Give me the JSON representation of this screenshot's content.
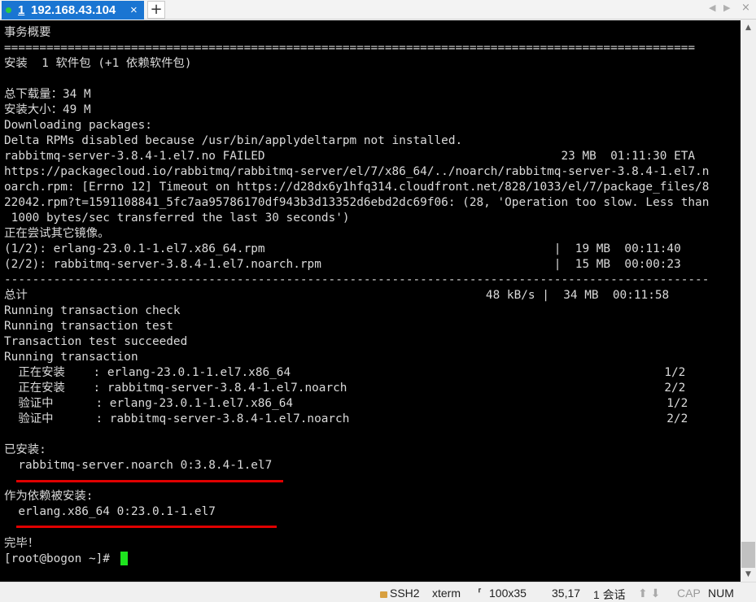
{
  "tab": {
    "number": "1",
    "host": "192.168.43.104",
    "close_glyph": "×",
    "new_tab_glyph": "+",
    "status_color": "#2ecc40"
  },
  "tab_nav": {
    "left": "◀",
    "right": "▶",
    "close": "×"
  },
  "terminal": {
    "lines": [
      "事务概要",
      "==================================================================================================",
      "安装  1 软件包 (+1 依赖软件包)",
      "",
      "总下载量：34 M",
      "安装大小：49 M",
      "Downloading packages:",
      "Delta RPMs disabled because /usr/bin/applydeltarpm not installed.",
      "rabbitmq-server-3.8.4-1.el7.no FAILED                                          23 MB  01:11:30 ETA",
      "https://packagecloud.io/rabbitmq/rabbitmq-server/el/7/x86_64/../noarch/rabbitmq-server-3.8.4-1.el7.n",
      "oarch.rpm: [Errno 12] Timeout on https://d28dx6y1hfq314.cloudfront.net/828/1033/el/7/package_files/8",
      "22042.rpm?t=1591108841_5fc7aa95786170df943b3d13352d6ebd2dc69f06: (28, 'Operation too slow. Less than",
      " 1000 bytes/sec transferred the last 30 seconds')",
      "正在尝试其它镜像。",
      "(1/2): erlang-23.0.1-1.el7.x86_64.rpm                                         |  19 MB  00:11:40",
      "(2/2): rabbitmq-server-3.8.4-1.el7.noarch.rpm                                 |  15 MB  00:00:23",
      "----------------------------------------------------------------------------------------------------",
      "总计                                                                 48 kB/s |  34 MB  00:11:58",
      "Running transaction check",
      "Running transaction test",
      "Transaction test succeeded",
      "Running transaction",
      "  正在安装    : erlang-23.0.1-1.el7.x86_64                                                     1/2",
      "  正在安装    : rabbitmq-server-3.8.4-1.el7.noarch                                             2/2",
      "  验证中      : erlang-23.0.1-1.el7.x86_64                                                     1/2",
      "  验证中      : rabbitmq-server-3.8.4-1.el7.noarch                                             2/2",
      "",
      "已安装:",
      "  rabbitmq-server.noarch 0:3.8.4-1.el7",
      "",
      "作为依赖被安装:",
      "  erlang.x86_64 0:23.0.1-1.el7",
      "",
      "完毕！",
      "[root@bogon ~]# "
    ],
    "cursor_color": "#1ee51e",
    "underline_color": "#e00000"
  },
  "scrollbar": {
    "up": "▲",
    "down": "▼"
  },
  "statusbar": {
    "protocol": "SSH2",
    "terminal_type": "xterm",
    "size": "100x35",
    "cursor_pos": "35,17",
    "sessions": "1 会话",
    "caps": "CAP",
    "num": "NUM",
    "size_icon": "⸢",
    "arrows": "⬆ ⬇"
  }
}
